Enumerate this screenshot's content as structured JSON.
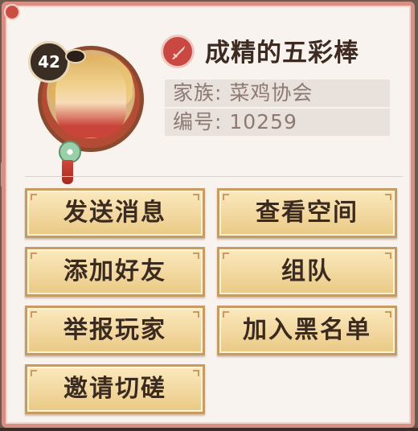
{
  "player": {
    "name": "成精的五彩棒",
    "level": "42",
    "clan_line": "家族: 菜鸡协会",
    "id_line": "编号: 10259"
  },
  "actions": [
    {
      "label": "发送消息"
    },
    {
      "label": "查看空间"
    },
    {
      "label": "添加好友"
    },
    {
      "label": "组队"
    },
    {
      "label": "举报玩家"
    },
    {
      "label": "加入黑名单"
    },
    {
      "label": "邀请切磋"
    }
  ],
  "colors": {
    "panel_border": "#d98f84",
    "button_gold": "#f2d79f",
    "accent_red": "#c94842"
  },
  "icons": [
    "level-badge",
    "eye-icon",
    "jade-pendant-icon",
    "sword-icon"
  ]
}
